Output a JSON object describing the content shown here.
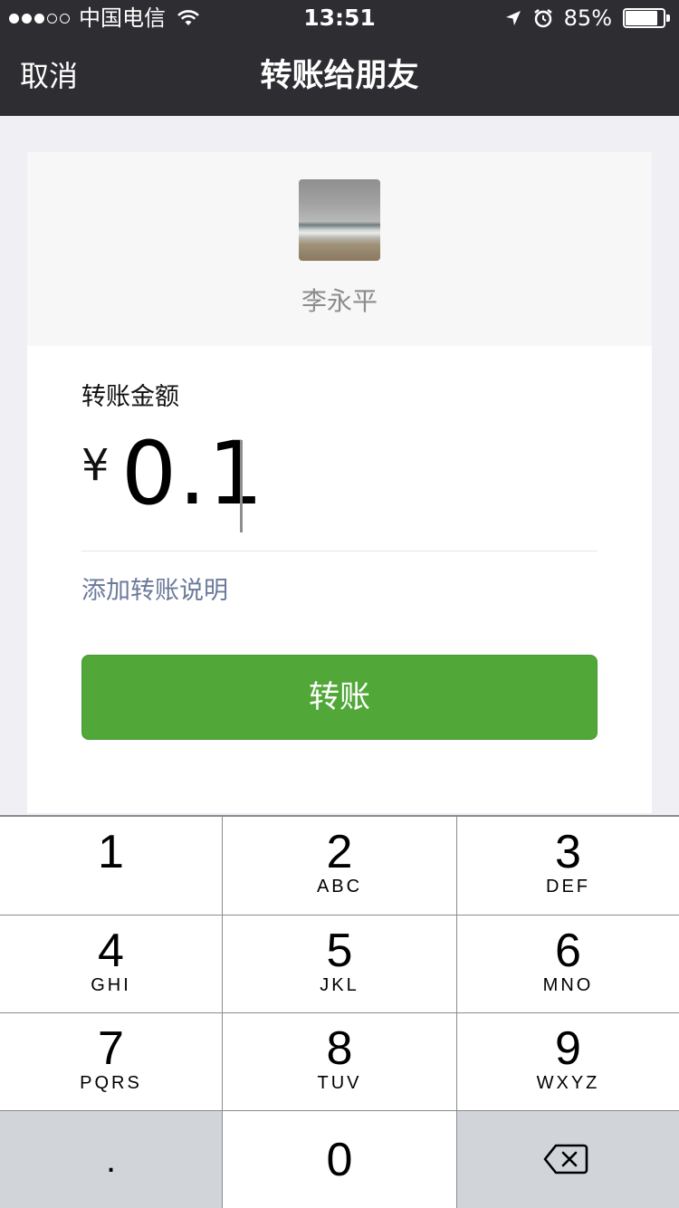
{
  "status_bar": {
    "carrier": "中国电信",
    "time": "13:51",
    "battery": "85%",
    "battery_level": 0.85
  },
  "nav": {
    "cancel": "取消",
    "title": "转账给朋友"
  },
  "recipient": {
    "name": "李永平"
  },
  "amount": {
    "label": "转账金额",
    "currency": "¥",
    "value": "0.1"
  },
  "add_note": "添加转账说明",
  "transfer_button": "转账",
  "keypad": {
    "keys": [
      {
        "digit": "1",
        "letters": ""
      },
      {
        "digit": "2",
        "letters": "ABC"
      },
      {
        "digit": "3",
        "letters": "DEF"
      },
      {
        "digit": "4",
        "letters": "GHI"
      },
      {
        "digit": "5",
        "letters": "JKL"
      },
      {
        "digit": "6",
        "letters": "MNO"
      },
      {
        "digit": "7",
        "letters": "PQRS"
      },
      {
        "digit": "8",
        "letters": "TUV"
      },
      {
        "digit": "9",
        "letters": "WXYZ"
      }
    ],
    "dot": ".",
    "zero": "0",
    "backspace_icon": "backspace-icon"
  },
  "colors": {
    "nav_bg": "#2e2e32",
    "button_green": "#51a838",
    "link_blue": "#6b7a9b"
  }
}
